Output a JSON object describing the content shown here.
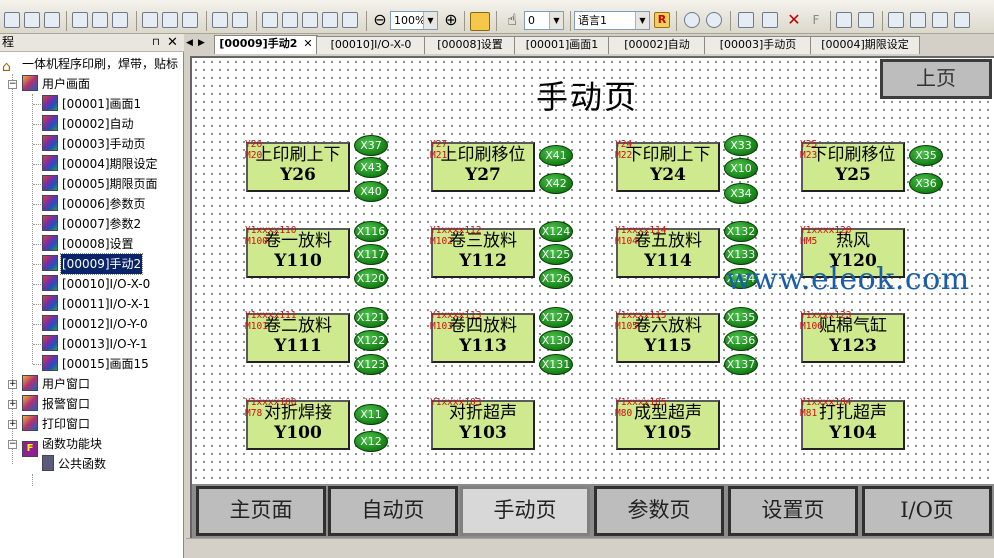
{
  "toolbar": {
    "zoom": "100%",
    "value_combo": "0",
    "language_combo": "语言1"
  },
  "leftpanel": {
    "header": "程",
    "root": "一体机程序印刷，焊带，贴标",
    "user_screens": "用户画面",
    "screens": [
      "[00001]画面1",
      "[00002]自动",
      "[00003]手动页",
      "[00004]期限设定",
      "[00005]期限页面",
      "[00006]参数页",
      "[00007]参数2",
      "[00008]设置",
      "[00009]手动2",
      "[00010]I/O-X-0",
      "[00011]I/O-X-1",
      "[00012]I/O-Y-0",
      "[00013]I/O-Y-1",
      "[00015]画面15"
    ],
    "user_window": "用户窗口",
    "alarm_window": "报警窗口",
    "print_window": "打印窗口",
    "function_block": "函数功能块",
    "public_function": "公共函数"
  },
  "tabs": [
    "[00009]手动2",
    "[00010]I/O-X-0",
    "[00008]设置",
    "[00001]画面1",
    "[00002]自动",
    "[00003]手动页",
    "[00004]期限设定"
  ],
  "canvas": {
    "title": "手动页",
    "up_button": "上页",
    "watermark": "www.eleok.com",
    "buttons": [
      {
        "l1": "上印刷上下",
        "l2": "Y26",
        "tag1": "Y26",
        "tag2": "M20"
      },
      {
        "l1": "上印刷移位",
        "l2": "Y27",
        "tag1": "Y27",
        "tag2": "M21"
      },
      {
        "l1": "下印刷上下",
        "l2": "Y24",
        "tag1": "Y24",
        "tag2": "M22"
      },
      {
        "l1": "下印刷移位",
        "l2": "Y25",
        "tag1": "Y25",
        "tag2": "M23"
      },
      {
        "l1": "卷一放料",
        "l2": "Y110",
        "tag1": "Y1xxxx110",
        "tag2": "M100"
      },
      {
        "l1": "卷三放料",
        "l2": "Y112",
        "tag1": "Y1xxxx112",
        "tag2": "M102"
      },
      {
        "l1": "卷五放料",
        "l2": "Y114",
        "tag1": "Y1xxxx114",
        "tag2": "M104"
      },
      {
        "l1": "热风",
        "l2": "Y120",
        "tag1": "Y1xxxx120",
        "tag2": "HM5"
      },
      {
        "l1": "卷二放料",
        "l2": "Y111",
        "tag1": "Y1xxxx111",
        "tag2": "M101"
      },
      {
        "l1": "卷四放料",
        "l2": "Y113",
        "tag1": "Y1xxxx113",
        "tag2": "M103"
      },
      {
        "l1": "卷六放料",
        "l2": "Y115",
        "tag1": "Y1xxxx115",
        "tag2": "M105"
      },
      {
        "l1": "贴棉气缸",
        "l2": "Y123",
        "tag1": "Y1xxxx123",
        "tag2": "M106"
      },
      {
        "l1": "对折焊接",
        "l2": "Y100",
        "tag1": "Y1xxxx100",
        "tag2": "M78"
      },
      {
        "l1": "对折超声",
        "l2": "Y103",
        "tag1": "Y1xxxx103",
        "tag2": ""
      },
      {
        "l1": "成型超声",
        "l2": "Y105",
        "tag1": "Y1xxxx105",
        "tag2": "M80"
      },
      {
        "l1": "打扎超声",
        "l2": "Y104",
        "tag1": "Y1xxxx104",
        "tag2": "M81"
      }
    ],
    "lamps": [
      "X37",
      "X43",
      "X40",
      "X41",
      "X42",
      "X33",
      "X10",
      "X34",
      "X35",
      "X36",
      "X116",
      "X117",
      "X120",
      "X124",
      "X125",
      "X126",
      "X132",
      "X133",
      "X134",
      "X121",
      "X122",
      "X123",
      "X127",
      "X130",
      "X131",
      "X135",
      "X136",
      "X137",
      "X11",
      "X12"
    ]
  },
  "bottom_nav": [
    "主页面",
    "自动页",
    "手动页",
    "参数页",
    "设置页",
    "I/O页"
  ]
}
